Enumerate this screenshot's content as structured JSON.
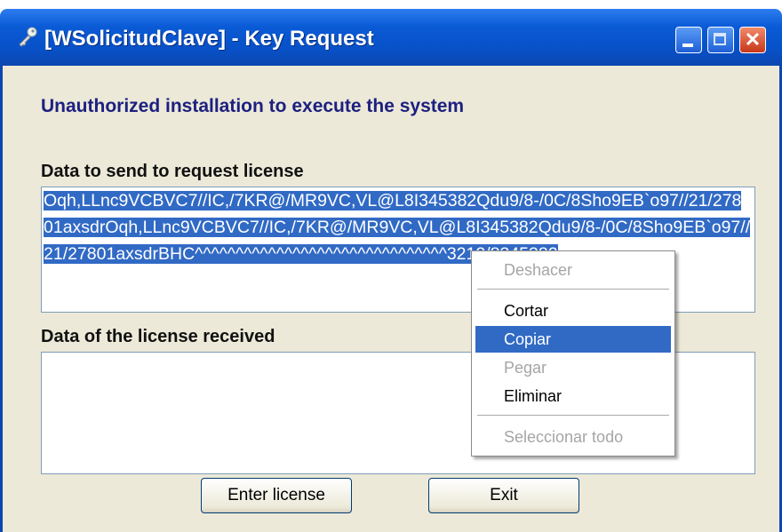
{
  "window": {
    "title": "[WSolicitudClave] - Key Request",
    "icon": "key-icon",
    "controls": {
      "minimize": "minimize-icon",
      "maximize": "maximize-icon",
      "close": "close-icon"
    },
    "accent": "#0a5bd6"
  },
  "main": {
    "message": "Unauthorized installation to execute the system",
    "request_label": "Data to send to request license",
    "request_value": "Oqh,LLnc9VCBVC7//IC,/7KR@/MR9VC,VL@L8I345382Qdu9/8-/0C/8Sho9EB`o97//21/27801axsdrOqh,LLnc9VCBVC7//IC,/7KR@/MR9VC,VL@L8I345382Qdu9/8-/0C/8Sho9EB`o97//21/27801axsdrBHC^^^^^^^^^^^^^^^^^^^^^^^^^^^^^^^3212/8345382",
    "received_label": "Data of the license received",
    "received_value": "",
    "selection_color": "#316ac5"
  },
  "buttons": {
    "enter": "Enter license",
    "exit": "Exit"
  },
  "context_menu": {
    "items": [
      {
        "label": "Deshacer",
        "enabled": false
      },
      {
        "label": "Cortar",
        "enabled": true
      },
      {
        "label": "Copiar",
        "enabled": true,
        "highlighted": true
      },
      {
        "label": "Pegar",
        "enabled": false
      },
      {
        "label": "Eliminar",
        "enabled": true
      },
      {
        "label": "Seleccionar todo",
        "enabled": false
      }
    ]
  }
}
